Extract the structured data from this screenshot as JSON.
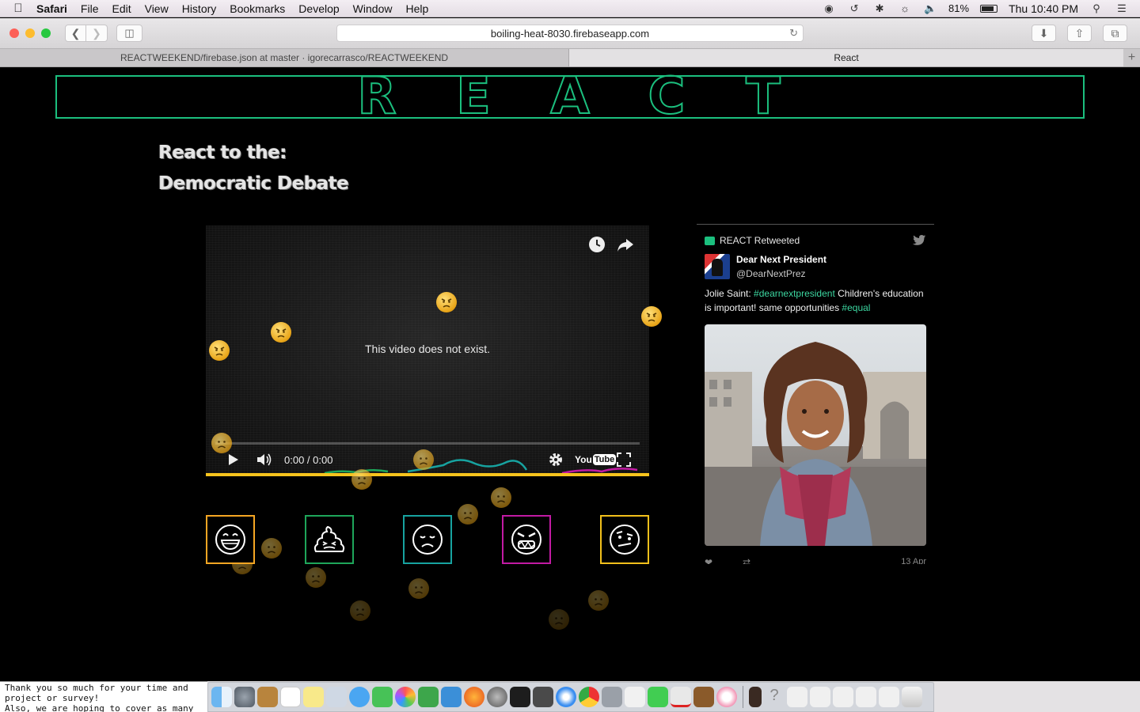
{
  "menubar": {
    "app_name": "Safari",
    "items": [
      "File",
      "Edit",
      "View",
      "History",
      "Bookmarks",
      "Develop",
      "Window",
      "Help"
    ],
    "battery_percent": "81%",
    "clock": "Thu 10:40 PM"
  },
  "browser": {
    "url": "boiling-heat-8030.firebaseapp.com",
    "tabs": [
      {
        "label": "REACTWEEKEND/firebase.json at master · igorecarrasco/REACTWEEKEND",
        "active": false
      },
      {
        "label": "React",
        "active": true
      }
    ]
  },
  "page": {
    "logo_letters": [
      "R",
      "E",
      "A",
      "C",
      "T"
    ],
    "headline_line1": "React to the:",
    "headline_line2": "Democratic Debate",
    "colors": {
      "accent_green": "#1bbf7e",
      "happy": "#f5a623",
      "poop": "#1ea65a",
      "sad": "#17a3a0",
      "angry": "#c21aa4",
      "skeptical": "#f2c01b",
      "reaction_bar": "#f7c41d"
    },
    "video": {
      "message": "This video does not exist.",
      "time": "0:00 / 0:00",
      "youtube_label": "You",
      "youtube_tube": "Tube"
    },
    "reactions": [
      {
        "name": "happy",
        "icon": "grinning-face-icon"
      },
      {
        "name": "poop",
        "icon": "poop-icon"
      },
      {
        "name": "sad",
        "icon": "sad-face-icon"
      },
      {
        "name": "angry",
        "icon": "angry-face-icon"
      },
      {
        "name": "skeptical",
        "icon": "skeptical-face-icon"
      }
    ]
  },
  "tweet": {
    "retweet_label": "REACT Retweeted",
    "name": "Dear Next President",
    "handle": "@DearNextPrez",
    "text_prefix": "Jolie Saint: ",
    "hashtag1": "#dearnextpresident",
    "text_middle": " Children's education is important! same opportunities ",
    "hashtag2": "#equal",
    "date": "13 Apr"
  },
  "terminal": {
    "line1": "Thank you so much for your time and",
    "line2": "project or survey!",
    "line3": "Also, we are hoping to cover as many"
  }
}
